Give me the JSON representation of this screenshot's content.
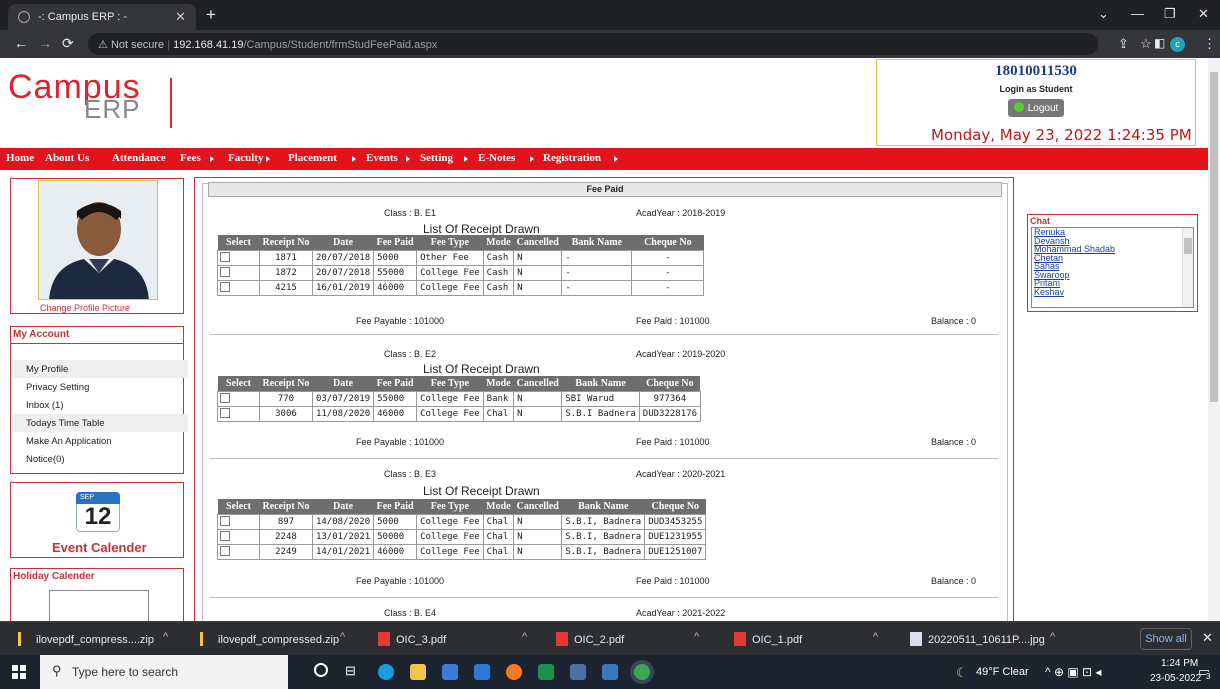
{
  "browser": {
    "tab_title": "-: Campus ERP : -",
    "url_prefix": "Not secure",
    "url_host": "192.168.41.19",
    "url_path": "/Campus/Student/frmStudFeePaid.aspx",
    "profile_letter": "c"
  },
  "logo": {
    "part1": "Campus",
    "part2": "ERP"
  },
  "user": {
    "id": "18010011530",
    "role": "Login as Student",
    "logout_label": "Logout",
    "datetime": "Monday, May 23, 2022 1:24:35 PM"
  },
  "menu": [
    "Home",
    "About Us",
    "Attendance",
    "Fees",
    "Faculty",
    "Placement",
    "Events",
    "Setting",
    "E-Notes",
    "Registration"
  ],
  "sidebar": {
    "change_pic": "Change Profile Picture",
    "account_title": "My Account",
    "account_items": [
      "My Profile",
      "Privacy Setting",
      "Inbox (1)",
      "Todays Time Table",
      "Make An Application",
      "Notice(0)"
    ],
    "cal_month": "SEP",
    "cal_day": "12",
    "event_calendar": "Event Calender",
    "holiday_title": "Holiday Calender"
  },
  "fee": {
    "header": "Fee Paid",
    "list_title": "List Of Receipt Drawn",
    "columns": [
      "Select",
      "Receipt No",
      "Date",
      "Fee Paid",
      "Fee Type",
      "Mode",
      "Cancelled",
      "Bank Name",
      "Cheque No"
    ],
    "sections": [
      {
        "class": "Class : B. E1",
        "year": "AcadYear : 2018-2019",
        "rows": [
          [
            "1871",
            "20/07/2018",
            "5000",
            "Other Fee",
            "Cash",
            "N",
            "-",
            "-"
          ],
          [
            "1872",
            "20/07/2018",
            "55000",
            "College Fee",
            "Cash",
            "N",
            "-",
            "-"
          ],
          [
            "4215",
            "16/01/2019",
            "46000",
            "College Fee",
            "Cash",
            "N",
            "-",
            "-"
          ]
        ],
        "payable": "Fee Payable : 101000",
        "paid": "Fee Paid : 101000",
        "balance": "Balance : 0"
      },
      {
        "class": "Class : B. E2",
        "year": "AcadYear : 2019-2020",
        "rows": [
          [
            "770",
            "03/07/2019",
            "55000",
            "College Fee",
            "Bank",
            "N",
            "SBI Warud",
            "977364"
          ],
          [
            "3006",
            "11/08/2020",
            "46000",
            "College Fee",
            "Chal",
            "N",
            "S.B.I Badnera",
            "DUD3228176"
          ]
        ],
        "payable": "Fee Payable : 101000",
        "paid": "Fee Paid : 101000",
        "balance": "Balance : 0"
      },
      {
        "class": "Class : B. E3",
        "year": "AcadYear : 2020-2021",
        "rows": [
          [
            "897",
            "14/08/2020",
            "5000",
            "College Fee",
            "Chal",
            "N",
            "S.B.I, Badnera",
            "DUD3453255"
          ],
          [
            "2248",
            "13/01/2021",
            "50000",
            "College Fee",
            "Chal",
            "N",
            "S.B.I, Badnera",
            "DUE1231955"
          ],
          [
            "2249",
            "14/01/2021",
            "46000",
            "College Fee",
            "Chal",
            "N",
            "S.B.I, Badnera",
            "DUE1251007"
          ]
        ],
        "payable": "Fee Payable : 101000",
        "paid": "Fee Paid : 101000",
        "balance": "Balance : 0"
      },
      {
        "class": "Class : B. E4",
        "year": "AcadYear : 2021-2022"
      }
    ]
  },
  "chat": {
    "title": "Chat",
    "users": [
      "Renuka",
      "Devansh",
      "Mohammad Shadab",
      "Chetan",
      "Sahas",
      "Swaroop",
      "Pritam",
      "Keshav"
    ]
  },
  "downloads": {
    "items": [
      "ilovepdf_compress....zip",
      "ilovepdf_compressed.zip",
      "OIC_3.pdf",
      "OIC_2.pdf",
      "OIC_1.pdf",
      "20220511_10611P....jpg"
    ],
    "show_all": "Show all"
  },
  "taskbar": {
    "search_placeholder": "Type here to search",
    "weather": "49°F  Clear",
    "time": "1:24 PM",
    "date": "23-05-2022",
    "notif_count": "3"
  }
}
